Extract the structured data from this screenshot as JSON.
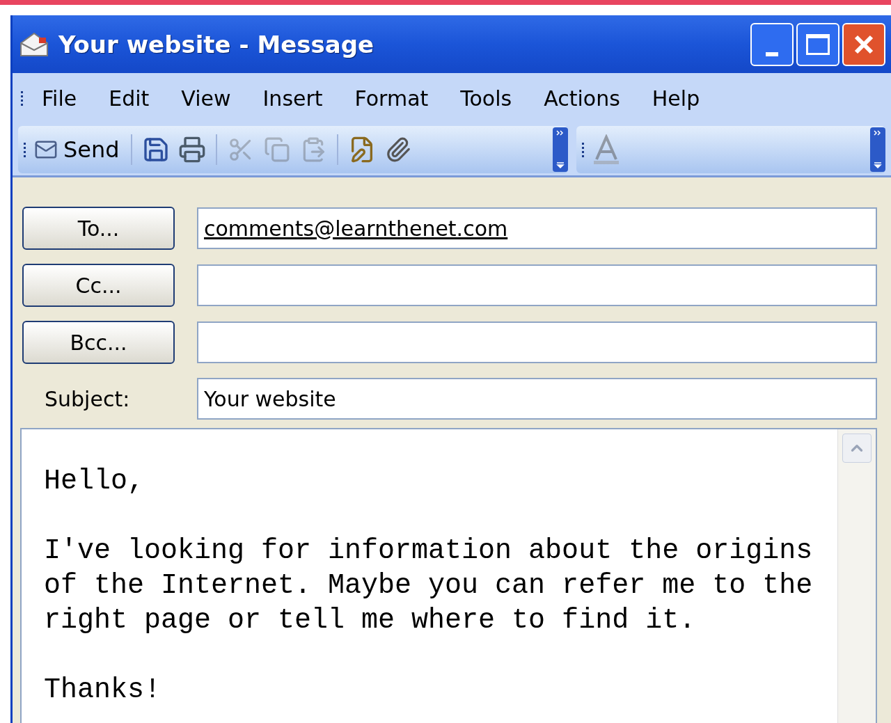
{
  "window": {
    "title": "Your website - Message"
  },
  "menu": [
    "File",
    "Edit",
    "View",
    "Insert",
    "Format",
    "Tools",
    "Actions",
    "Help"
  ],
  "toolbar": {
    "send_label": "Send",
    "cut_disabled": true,
    "copy_disabled": true,
    "paste_disabled": true
  },
  "address_rows": [
    {
      "kind": "button",
      "label": "To...",
      "value": "comments@learnthenet.com",
      "link": true
    },
    {
      "kind": "button",
      "label": "Cc..."
    },
    {
      "kind": "button",
      "label": "Bcc..."
    },
    {
      "kind": "label",
      "label": "Subject:",
      "value": "Your website",
      "link": false
    }
  ],
  "body": {
    "paragraphs": [
      "Hello,",
      "I've looking for information about the origins of the Internet. Maybe you can refer me to the right page or tell me where to find it.",
      "Thanks!"
    ]
  }
}
